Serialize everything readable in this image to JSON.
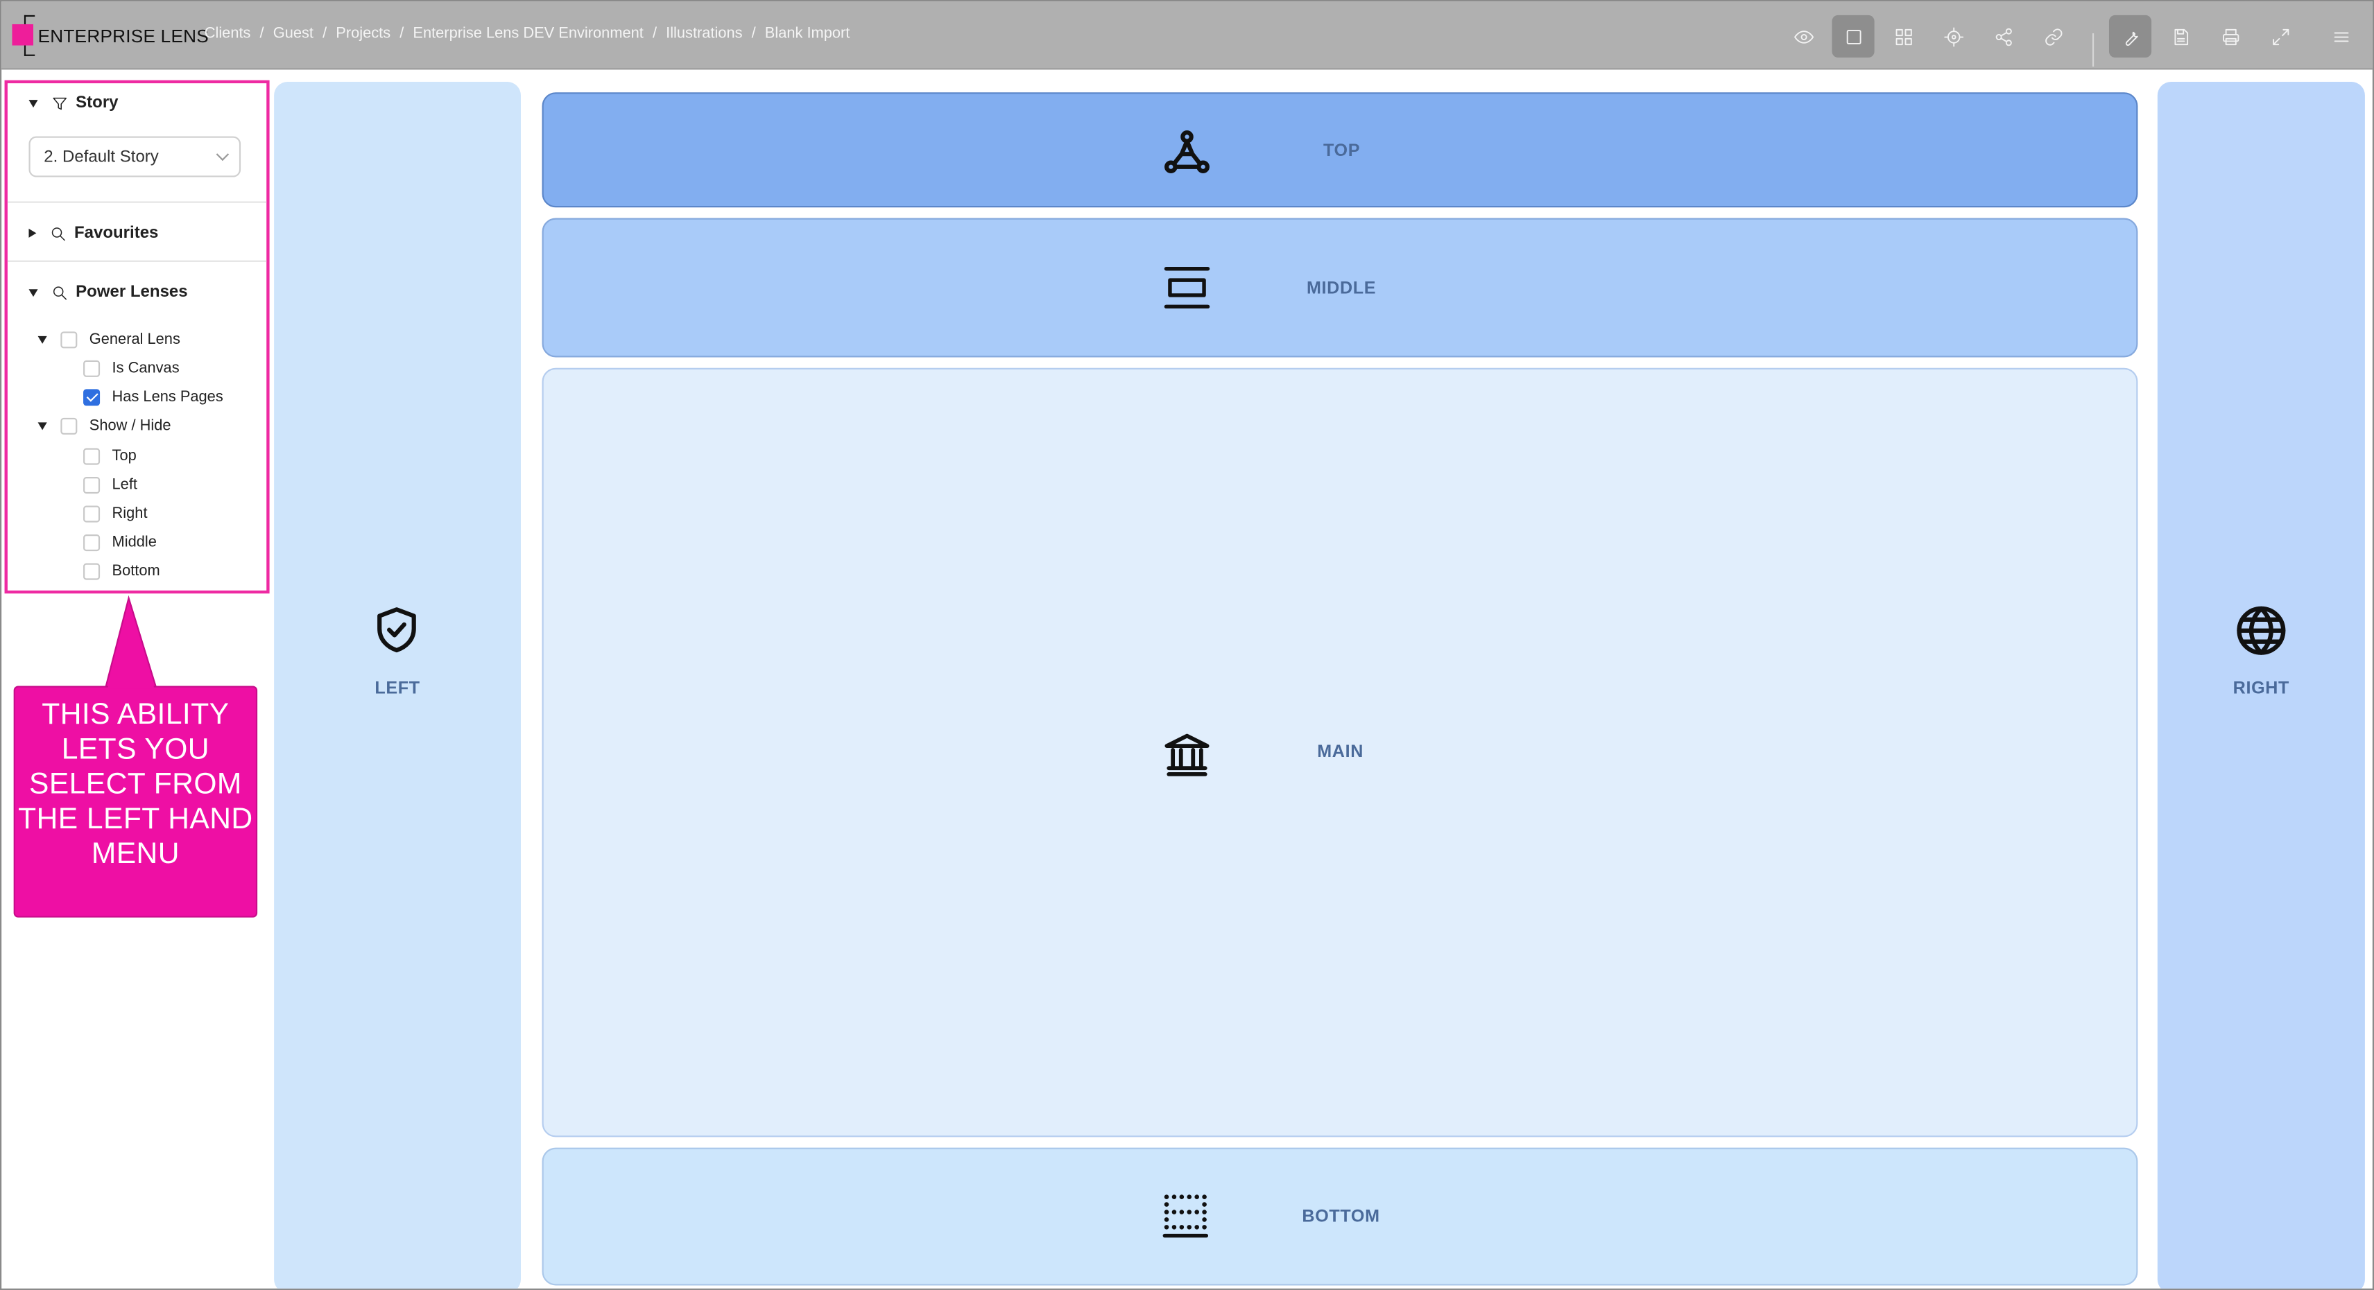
{
  "app": {
    "logo_text": "ENTERPRISE LENS",
    "breadcrumb": [
      "Clients",
      "Guest",
      "Projects",
      "Enterprise Lens DEV Environment",
      "Illustrations",
      "Blank Import"
    ],
    "breadcrumb_separator": "/"
  },
  "toolbar": {
    "icons": [
      "eye-icon",
      "single-frame-icon",
      "grid-icon",
      "target-icon",
      "share-icon",
      "link-icon",
      "wrench-icon",
      "save-icon",
      "print-icon",
      "expand-icon",
      "menu-icon"
    ],
    "active": [
      "single-frame-icon",
      "wrench-icon"
    ]
  },
  "sidebar": {
    "story": {
      "title": "Story",
      "selected": "2. Default Story"
    },
    "favourites": {
      "title": "Favourites"
    },
    "power_lenses": {
      "title": "Power Lenses",
      "groups": [
        {
          "label": "General Lens",
          "checked": false,
          "items": [
            {
              "label": "Is Canvas",
              "checked": false
            },
            {
              "label": "Has Lens Pages",
              "checked": true
            }
          ]
        },
        {
          "label": "Show / Hide",
          "checked": false,
          "items": [
            {
              "label": "Top",
              "checked": false
            },
            {
              "label": "Left",
              "checked": false
            },
            {
              "label": "Right",
              "checked": false
            },
            {
              "label": "Middle",
              "checked": false
            },
            {
              "label": "Bottom",
              "checked": false
            }
          ]
        }
      ]
    }
  },
  "callout": {
    "text": "THIS ABILITY LETS YOU SELECT FROM THE LEFT HAND MENU",
    "color": "#ee0fa4"
  },
  "panels": {
    "left": {
      "label": "LEFT",
      "icon": "shield-check-icon",
      "color": "#cfe5fb"
    },
    "right": {
      "label": "RIGHT",
      "icon": "globe-icon",
      "color": "#bcd6fb"
    },
    "top": {
      "label": "TOP",
      "icon": "network-icon",
      "color": "#82aef0"
    },
    "middle": {
      "label": "MIDDLE",
      "icon": "align-center-icon",
      "color": "#a9cbf9"
    },
    "main": {
      "label": "MAIN",
      "icon": "bank-icon",
      "color": "#e1eefc"
    },
    "bottom": {
      "label": "BOTTOM",
      "icon": "dotted-border-bottom-icon",
      "color": "#cde6fc"
    }
  }
}
